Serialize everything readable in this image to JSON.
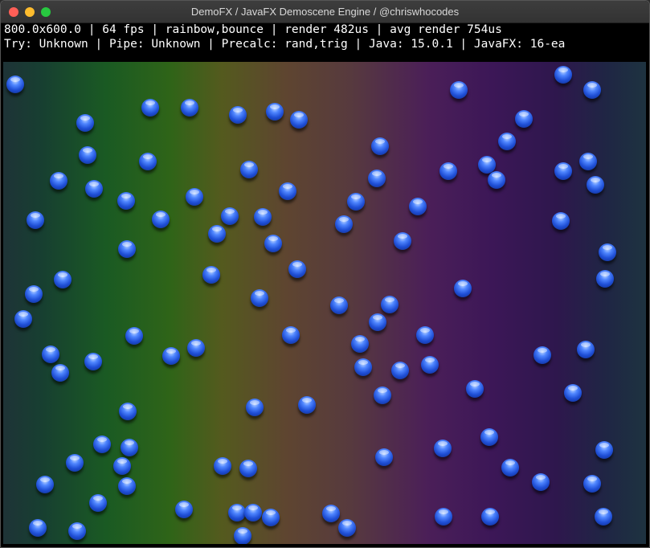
{
  "window": {
    "title": "DemoFX / JavaFX Demoscene Engine / @chriswhocodes"
  },
  "hud": {
    "line1": "800.0x600.0 | 64 fps | rainbow,bounce | render 482us | avg render 754us",
    "line2": "Try: Unknown | Pipe: Unknown | Precalc: rand,trig | Java: 15.0.1 | JavaFX: 16-ea"
  },
  "effects": {
    "background": "rainbow",
    "sprite": "bounce",
    "background_colors": [
      "#1e3337",
      "#1a5a23",
      "#545a1e",
      "#573a3e",
      "#3c1757",
      "#1e3340"
    ],
    "ball_color": "#3f74f0"
  },
  "traffic_lights": [
    "close",
    "minimize",
    "maximize"
  ]
}
